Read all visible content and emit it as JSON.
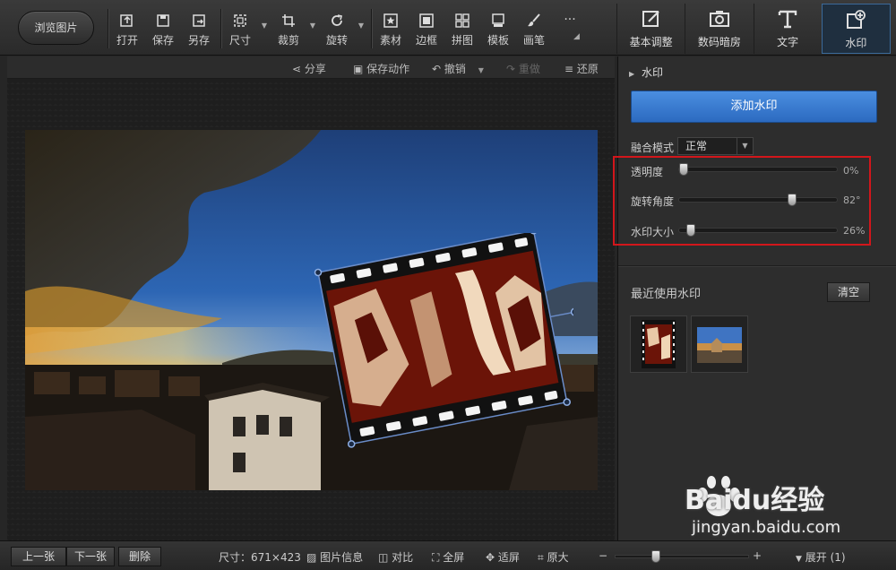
{
  "toolbar": {
    "browse_label": "浏览图片",
    "tools": [
      {
        "label": "打开",
        "icon": "open-icon"
      },
      {
        "label": "保存",
        "icon": "save-icon"
      },
      {
        "label": "另存",
        "icon": "save-as-icon"
      },
      {
        "label": "尺寸",
        "icon": "resize-icon"
      },
      {
        "label": "裁剪",
        "icon": "crop-icon"
      },
      {
        "label": "旋转",
        "icon": "rotate-icon"
      },
      {
        "label": "素材",
        "icon": "material-icon"
      },
      {
        "label": "边框",
        "icon": "border-icon"
      },
      {
        "label": "拼图",
        "icon": "collage-icon"
      },
      {
        "label": "模板",
        "icon": "template-icon"
      },
      {
        "label": "画笔",
        "icon": "brush-icon"
      }
    ],
    "more": "···"
  },
  "right_tabs": [
    {
      "label": "基本调整",
      "icon": "edit-icon"
    },
    {
      "label": "数码暗房",
      "icon": "camera-icon"
    },
    {
      "label": "文字",
      "icon": "text-icon"
    },
    {
      "label": "水印",
      "icon": "watermark-icon",
      "active": true
    }
  ],
  "actions": {
    "share": "分享",
    "save_action": "保存动作",
    "undo": "撤销",
    "redo": "重做",
    "restore": "还原"
  },
  "panel": {
    "title": "水印",
    "add_watermark": "添加水印",
    "blend_mode_label": "融合模式",
    "blend_mode_value": "正常",
    "sliders": [
      {
        "label": "透明度",
        "value": 0,
        "display": "0%"
      },
      {
        "label": "旋转角度",
        "value": 82,
        "max": 100,
        "display": "82°"
      },
      {
        "label": "水印大小",
        "value": 26,
        "display": "26%"
      }
    ],
    "recent_title": "最近使用水印",
    "clear": "清空"
  },
  "bottom": {
    "prev": "上一张",
    "next": "下一张",
    "delete": "删除",
    "size": "尺寸：671×423",
    "info": "图片信息",
    "compare": "对比",
    "fullscreen": "全屏",
    "fit": "适屏",
    "original": "原大",
    "expand": "展开 (1)",
    "minus": "−",
    "plus": "+"
  },
  "watermark_site": {
    "brand": "Baidu经验",
    "url": "jingyan.baidu.com"
  },
  "colors": {
    "accent": "#2c6ac0",
    "highlight_box": "#d2161b"
  }
}
